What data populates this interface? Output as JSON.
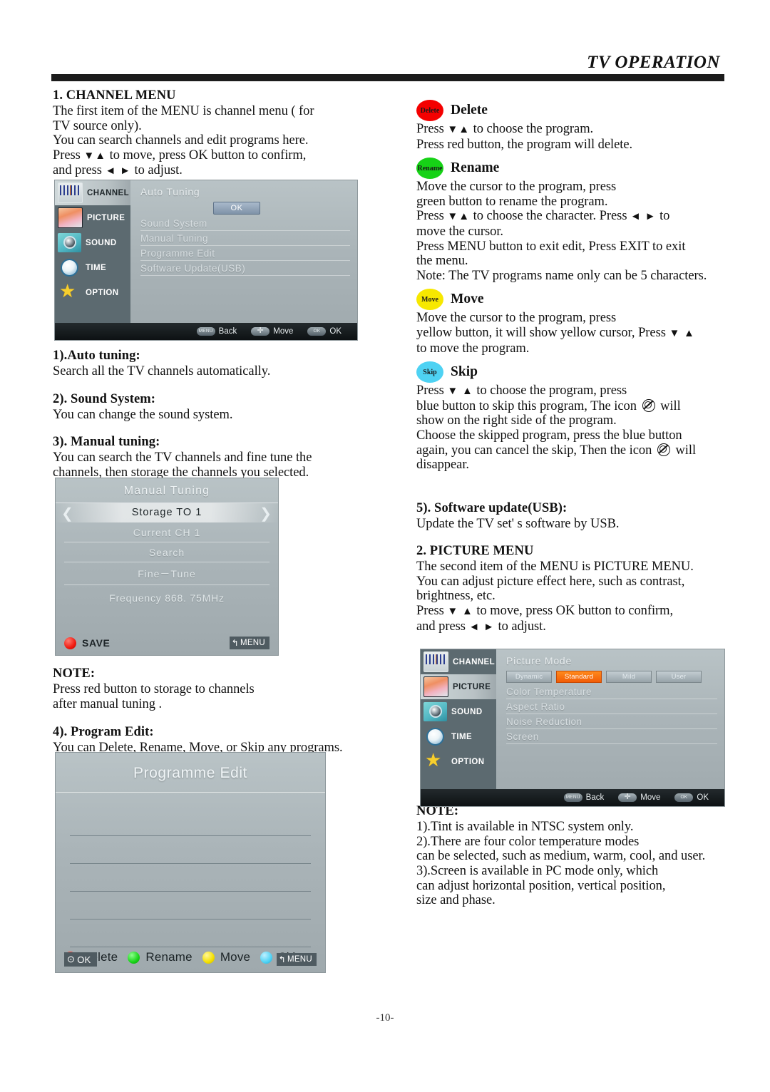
{
  "header": {
    "title": "TV OPERATION"
  },
  "page_number": "-10-",
  "left": {
    "s1_heading": "1. CHANNEL MENU",
    "s1_body": "The first item of the MENU is channel menu ( for TV source only).\nYou can search channels and edit programs here.\nPress ▼▲ to move, press OK button to confirm,\nand press ◄ ► to adjust.",
    "s1_line1": "The first item of the MENU is channel menu ( for",
    "s1_line2": "TV source only).",
    "s1_line3": "You can search channels and edit programs here.",
    "s1_line4a": "Press ",
    "s1_line4arrows": "▼▲",
    "s1_line4b": " to move, press OK button to confirm,",
    "s1_line5a": "and press ",
    "s1_line5arrows": "◄ ►",
    "s1_line5b": " to adjust.",
    "auto_heading": "1).Auto tuning:",
    "auto_body": "Search all the TV channels automatically.",
    "sound_heading": "2). Sound System:",
    "sound_body": "You can change the sound system.",
    "manual_heading": "3). Manual tuning:",
    "manual_body_l1": "You can search the TV channels and fine tune the",
    "manual_body_l2": "channels, then storage the channels you selected.",
    "note_heading": "NOTE:",
    "note_l1": "Press red button to storage to channels",
    "note_l2": "after manual tuning .",
    "progedit_heading": "4). Program Edit:",
    "progedit_body": "You can Delete, Rename, Move, or Skip any programs."
  },
  "right": {
    "delete": {
      "chip": "Delete",
      "label": "Delete",
      "l1a": "Press ",
      "l1arrows": "▼▲",
      "l1b": " to choose the program.",
      "l2": "Press red button, the program will delete."
    },
    "rename": {
      "chip": "Rename",
      "label": "Rename",
      "l1": "Move the cursor to the program, press",
      "l2": "green button to rename the program.",
      "l3a": "Press ",
      "l3arrows1": "▼▲",
      "l3b": " to choose the character. Press ",
      "l3arrows2": "◄ ►",
      "l3c": " to",
      "l4": "move the cursor.",
      "l5": "Press MENU button to exit edit, Press EXIT to exit",
      "l6": "the menu.",
      "l7": "Note: The TV programs name only can be 5 characters."
    },
    "move": {
      "chip": "Move",
      "label": "Move",
      "l1": "Move the cursor to the program, press",
      "l2a": "yellow button, it will show yellow cursor, Press ",
      "l2arrows": "▼ ▲",
      "l3": "to move the program."
    },
    "skip": {
      "chip": "Skip",
      "label": "Skip",
      "l1a": "Press ",
      "l1arrows": "▼ ▲",
      "l1b": " to choose the program, press",
      "l2a": "blue button to skip this program, The icon ",
      "l2b": " will",
      "l3": "show on the right side of the program.",
      "l4": "Choose the skipped program, press the blue button",
      "l5a": "again, you can cancel the skip, Then the icon ",
      "l5b": " will",
      "l6": "disappear."
    },
    "software_heading": "5). Software update(USB):",
    "software_body": "Update the TV set' s software by USB.",
    "picture_heading": "2. PICTURE MENU",
    "picture_l1": "The second item of the MENU is PICTURE MENU.",
    "picture_l2": "You can adjust picture effect here, such as contrast,",
    "picture_l3": "brightness, etc.",
    "picture_l4a": "Press ",
    "picture_l4arrows": "▼ ▲",
    "picture_l4b": " to move, press OK button to confirm,",
    "picture_l5a": "and press ",
    "picture_l5arrows": "◄ ►",
    "picture_l5b": " to adjust.",
    "note_heading": "NOTE:",
    "note_l1": "1).Tint is available in NTSC system only.",
    "note_l2": "2).There are four color temperature modes",
    "note_l3": "can be selected, such as medium, warm, cool, and user.",
    "note_l4": "3).Screen is available in PC mode only, which",
    "note_l5": "can adjust horizontal position, vertical position,",
    "note_l6": "size and phase."
  },
  "osd_channel": {
    "sidebar": [
      {
        "label": "CHANNEL",
        "icon": "channel-icon",
        "active": true
      },
      {
        "label": "PICTURE",
        "icon": "picture-icon",
        "active": false
      },
      {
        "label": "SOUND",
        "icon": "sound-icon",
        "active": false
      },
      {
        "label": "TIME",
        "icon": "clock-icon",
        "active": false
      },
      {
        "label": "OPTION",
        "icon": "star-icon",
        "active": false
      }
    ],
    "title": "Auto Tuning",
    "ok_button": "OK",
    "rows": [
      "Sound System",
      "Manual Tuning",
      "Programme Edit",
      "Software Update(USB)"
    ],
    "footer": [
      {
        "key": "MENU",
        "label": "Back"
      },
      {
        "key": "MOVE",
        "label": "Move"
      },
      {
        "key": "OK",
        "label": "OK"
      }
    ]
  },
  "osd_manual_tuning": {
    "title": "Manual Tuning",
    "selected_row": "Storage  TO  1",
    "arrow_left": "❮",
    "arrow_right": "❯",
    "rows": [
      "Current  CH  1",
      "Search",
      "Fine－Tune"
    ],
    "frequency": "Frequency  868. 75MHz",
    "save_label": "SAVE",
    "menu_tag": "MENU"
  },
  "osd_programme_edit": {
    "title": "Programme Edit",
    "legend": [
      {
        "color": "red",
        "label": "Delete"
      },
      {
        "color": "green",
        "label": "Rename"
      },
      {
        "color": "yellow",
        "label": "Move"
      },
      {
        "color": "blue",
        "label": "Skip"
      }
    ],
    "ok_label": "OK",
    "menu_tag": "MENU",
    "row_count": 6
  },
  "osd_picture": {
    "sidebar": [
      {
        "label": "CHANNEL",
        "icon": "channel-icon",
        "active": false
      },
      {
        "label": "PICTURE",
        "icon": "picture-icon",
        "active": true
      },
      {
        "label": "SOUND",
        "icon": "sound-icon",
        "active": false
      },
      {
        "label": "TIME",
        "icon": "clock-icon",
        "active": false
      },
      {
        "label": "OPTION",
        "icon": "star-icon",
        "active": false
      }
    ],
    "title": "Picture Mode",
    "modes": [
      "Dynamic",
      "Standard",
      "Mild",
      "User"
    ],
    "selected_mode": "Standard",
    "rows": [
      "Color Temperature",
      "Aspect Ratio",
      "Noise Reduction",
      "Screen"
    ],
    "footer": [
      {
        "key": "MENU",
        "label": "Back"
      },
      {
        "key": "MOVE",
        "label": "Move"
      },
      {
        "key": "OK",
        "label": "OK"
      }
    ]
  },
  "colors": {
    "red": "#f40000",
    "green": "#16d216",
    "yellow": "#f7e800",
    "blue": "#4ed2f3",
    "accent_orange": "#f25c06",
    "osd_sidebar": "#5c6a70"
  }
}
